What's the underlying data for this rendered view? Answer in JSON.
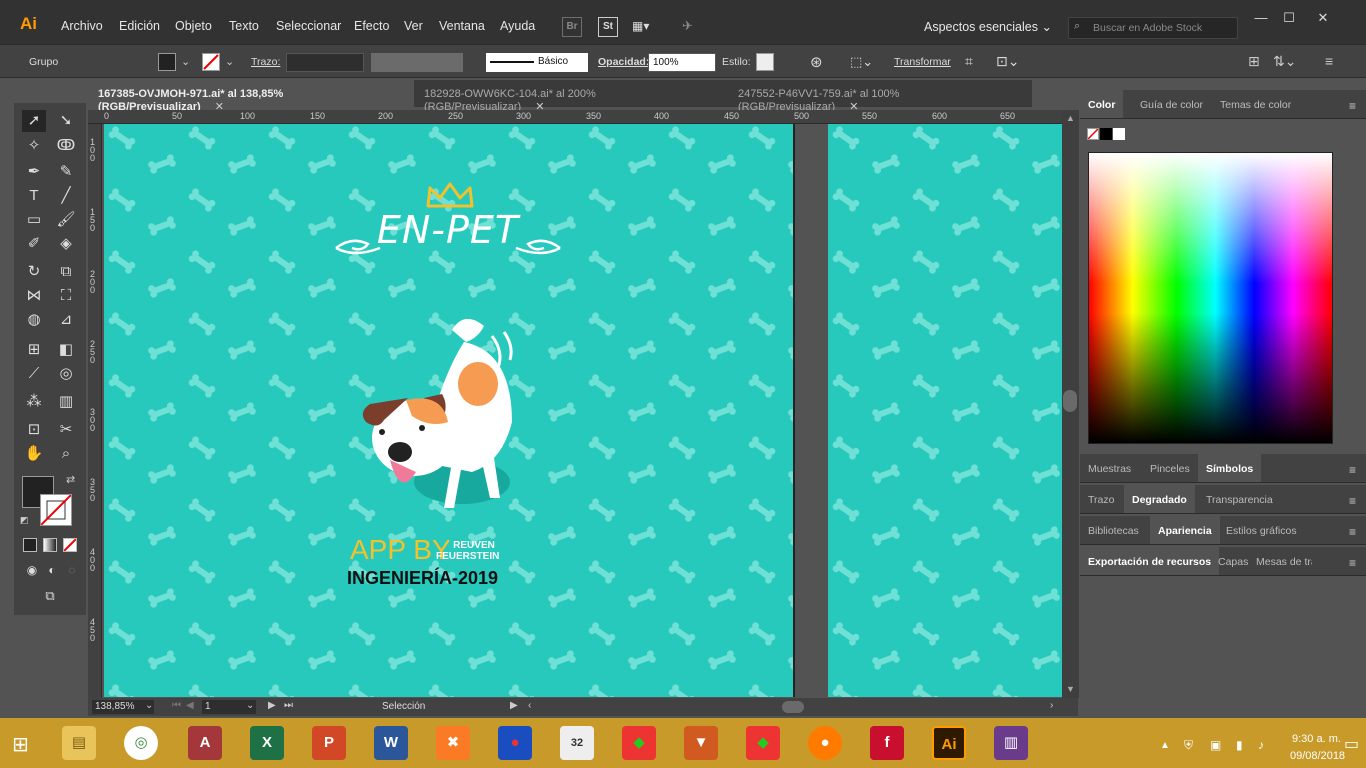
{
  "app": {
    "logo": "Ai"
  },
  "menu": [
    "Archivo",
    "Edición",
    "Objeto",
    "Texto",
    "Seleccionar",
    "Efecto",
    "Ver",
    "Ventana",
    "Ayuda"
  ],
  "menu_badges": [
    "Br",
    "St"
  ],
  "workspace": "Aspectos esenciales",
  "stock_placeholder": "Buscar en Adobe Stock",
  "control": {
    "selection_type": "Grupo",
    "stroke_label": "Trazo:",
    "brush_style": "Básico",
    "opacity_label": "Opacidad:",
    "opacity_value": "100%",
    "style_label": "Estilo:",
    "transform_label": "Transformar"
  },
  "tabs": [
    {
      "label": "167385-OVJMOH-971.ai* al 138,85% (RGB/Previsualizar)",
      "active": true
    },
    {
      "label": "182928-OWW6KC-104.ai* al 200% (RGB/Previsualizar)",
      "active": false
    },
    {
      "label": "247552-P46VV1-759.ai* al 100% (RGB/Previsualizar)",
      "active": false
    }
  ],
  "ruler_h": [
    "0",
    "50",
    "100",
    "150",
    "200",
    "250",
    "300",
    "350",
    "400",
    "450",
    "500",
    "550",
    "600",
    "650"
  ],
  "ruler_v": [
    "100",
    "150",
    "200",
    "250",
    "300",
    "350",
    "400",
    "450"
  ],
  "artwork": {
    "title": "EN-PET",
    "app_by": "APP BY",
    "author_line1": "REUVEN",
    "author_line2": "FEUERSTEIN",
    "subtitle": "INGENIERÍA-2019",
    "background_color": "#27c9bc",
    "accent_color": "#f2c12e"
  },
  "status": {
    "zoom": "138,85%",
    "artboard": "1",
    "tool": "Selección"
  },
  "panels": {
    "color_tabs": [
      "Color",
      "Guía de color",
      "Temas de color"
    ],
    "group2": [
      "Muestras",
      "Pinceles",
      "Símbolos"
    ],
    "group3": [
      "Trazo",
      "Degradado",
      "Transparencia"
    ],
    "group4": [
      "Bibliotecas",
      "Apariencia",
      "Estilos gráficos"
    ],
    "group5": [
      "Exportación de recursos",
      "Capas",
      "Mesas de tra"
    ]
  },
  "taskbar": {
    "time": "9:30 a. m.",
    "date": "09/08/2018",
    "apps": [
      "chrome",
      "access",
      "excel",
      "powerpoint",
      "word",
      "xampp",
      "game1",
      "game2",
      "game3",
      "game4",
      "fox",
      "game5",
      "firefox",
      "flash",
      "illustrator",
      "winrar"
    ]
  }
}
